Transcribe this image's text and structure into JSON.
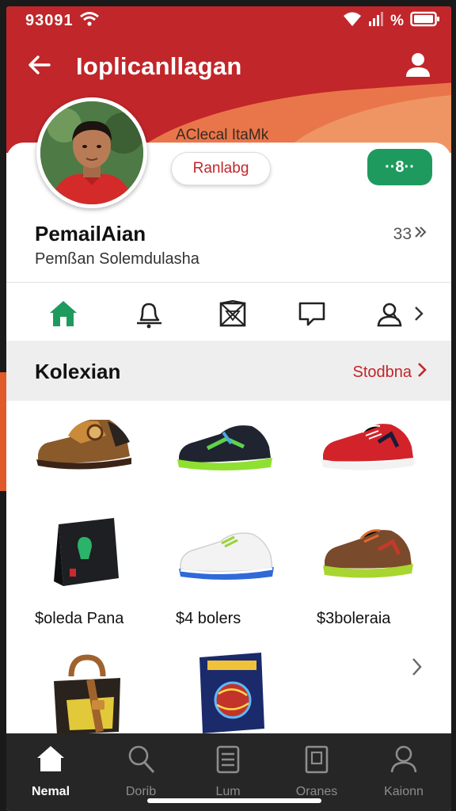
{
  "status_bar": {
    "time": "93091",
    "battery_text": "%"
  },
  "app_bar": {
    "title": "Ioplicanllagan"
  },
  "profile": {
    "subtitle": "AClecal ItaMk",
    "pill_button": "Ranlabg",
    "green_button": "··8··",
    "name": "PemailAian",
    "description": "Pemßan Solemdulashа",
    "count": "33"
  },
  "tabs": [
    {
      "icon": "home-icon",
      "active": true
    },
    {
      "icon": "bell-icon",
      "active": false
    },
    {
      "icon": "box-icon",
      "active": false
    },
    {
      "icon": "chat-icon",
      "active": false
    },
    {
      "icon": "people-icon",
      "active": false
    }
  ],
  "section": {
    "title": "Kolexian",
    "link": "Stodbna"
  },
  "products": [
    {
      "icon": "brown-shoe-image",
      "label": ""
    },
    {
      "icon": "black-green-sneaker-image",
      "label": ""
    },
    {
      "icon": "red-sneaker-image",
      "label": ""
    },
    {
      "icon": "black-bag-image",
      "label": "$oleda Pana"
    },
    {
      "icon": "white-sneaker-image",
      "label": "$4 bolers"
    },
    {
      "icon": "brown-trail-shoe-image",
      "label": "$3boleraia"
    },
    {
      "icon": "leather-bag-image",
      "label": ""
    },
    {
      "icon": "game-box-image",
      "label": ""
    }
  ],
  "bottom_nav": [
    {
      "icon": "home-icon",
      "label": "Nemal",
      "active": true
    },
    {
      "icon": "search-icon",
      "label": "Dorib",
      "active": false
    },
    {
      "icon": "list-icon",
      "label": "Lum",
      "active": false
    },
    {
      "icon": "clipboard-icon",
      "label": "Oranes",
      "active": false
    },
    {
      "icon": "user-icon",
      "label": "Kaionn",
      "active": false
    }
  ],
  "colors": {
    "brand_red": "#c1262a",
    "accent_green": "#1f9a5e",
    "nav_bg": "#262626"
  }
}
